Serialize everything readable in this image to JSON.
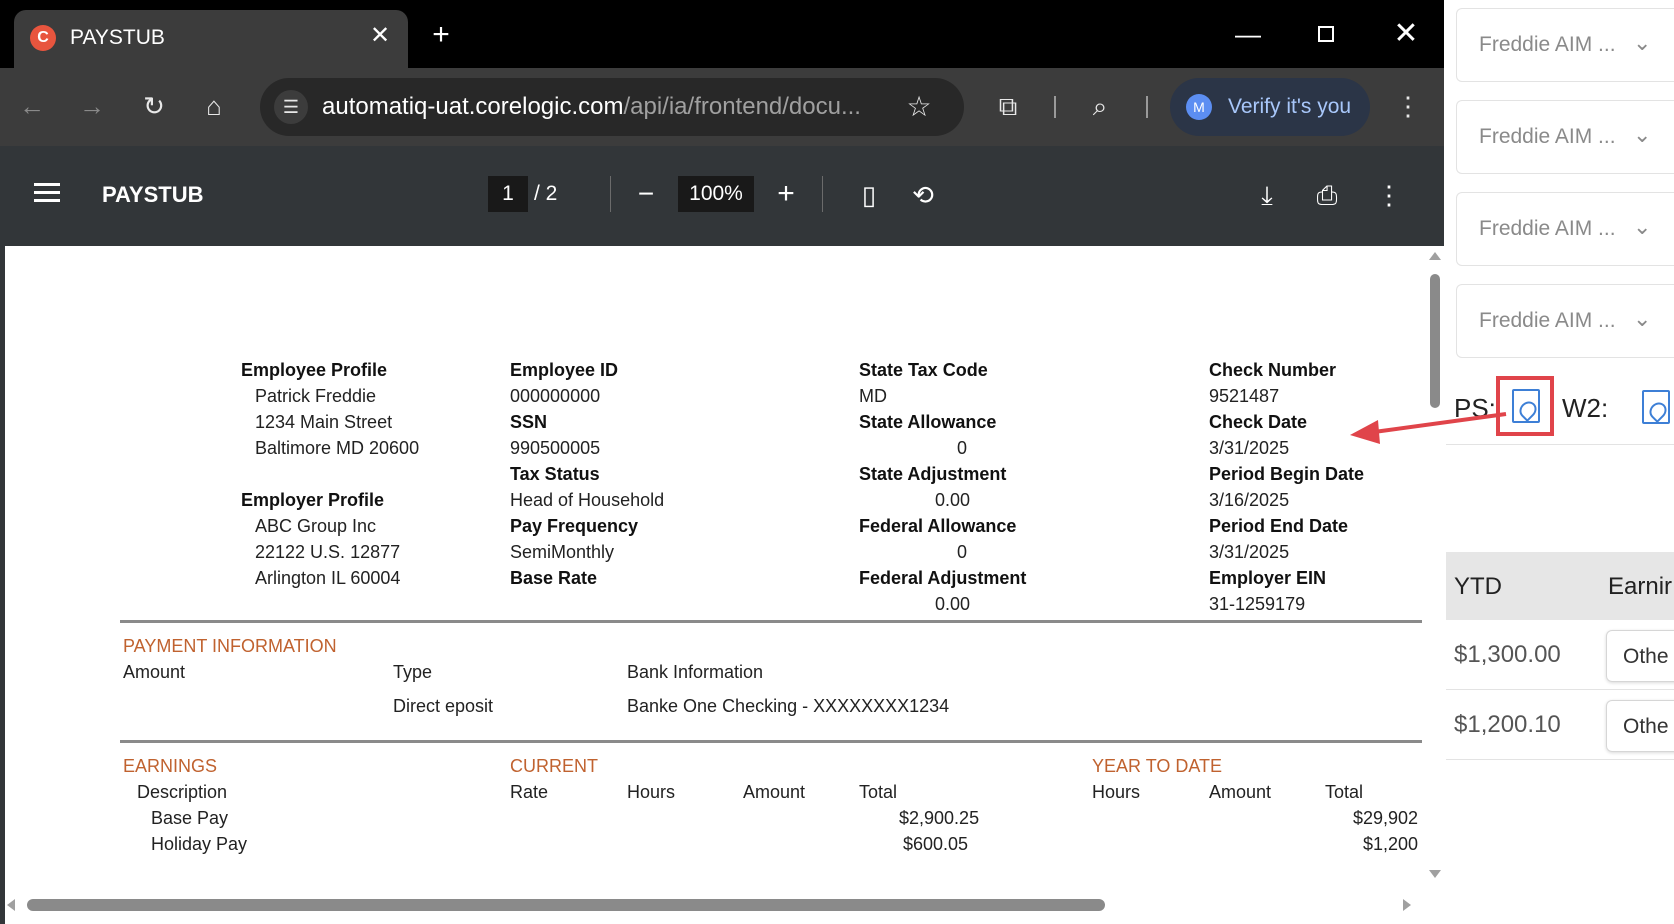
{
  "browser": {
    "tab_title": "PAYSTUB",
    "url_host": "automatiq-uat.corelogic.com",
    "url_path": "/api/ia/frontend/docu...",
    "verify_label": "Verify it's you",
    "avatar_initial": "M"
  },
  "pdf_viewer": {
    "title": "PAYSTUB",
    "current_page": "1",
    "page_total": "/ 2",
    "zoom": "100%"
  },
  "document": {
    "col1": {
      "employee_profile_label": "Employee Profile",
      "employee_name": "Patrick  Freddie",
      "employee_street": "1234 Main Street",
      "employee_city": "Baltimore MD 20600",
      "employer_profile_label": "Employer Profile",
      "employer_name": "ABC Group Inc",
      "employer_street": "22122 U.S. 12877",
      "employer_city": "Arlington IL 60004"
    },
    "col2": {
      "employee_id_label": "Employee ID",
      "employee_id": "000000000",
      "ssn_label": "SSN",
      "ssn": "990500005",
      "tax_status_label": "Tax Status",
      "tax_status": "Head of Household",
      "pay_frequency_label": "Pay Frequency",
      "pay_frequency": "SemiMonthly",
      "base_rate_label": "Base Rate"
    },
    "col3": {
      "state_tax_code_label": "State Tax Code",
      "state_tax_code": "MD",
      "state_allowance_label": "State Allowance",
      "state_allowance": "0",
      "state_adjustment_label": "State Adjustment",
      "state_adjustment": "0.00",
      "federal_allowance_label": "Federal Allowance",
      "federal_allowance": "0",
      "federal_adjustment_label": "Federal Adjustment",
      "federal_adjustment": "0.00"
    },
    "col4": {
      "check_number_label": "Check Number",
      "check_number": "9521487",
      "check_date_label": "Check Date",
      "check_date": "3/31/2025",
      "period_begin_label": "Period Begin Date",
      "period_begin": "3/16/2025",
      "period_end_label": "Period End Date",
      "period_end": "3/31/2025",
      "employer_ein_label": "Employer EIN",
      "employer_ein": "31-1259179"
    },
    "payment": {
      "heading": "PAYMENT INFORMATION",
      "amount_label": "Amount",
      "type_label": "Type",
      "bank_label": "Bank Information",
      "type_value": "Direct eposit",
      "bank_value": "Banke One Checking - XXXXXXXX1234"
    },
    "earnings": {
      "heading": "EARNINGS",
      "current_heading": "CURRENT",
      "ytd_heading": "YEAR TO DATE",
      "columns": {
        "description": "Description",
        "rate": "Rate",
        "hours": "Hours",
        "amount": "Amount",
        "total": "Total",
        "ytd_hours": "Hours",
        "ytd_amount": "Amount",
        "ytd_total": "Total"
      },
      "rows": [
        {
          "description": "Base Pay",
          "current_total": "$2,900.25",
          "ytd_total": "$29,902"
        },
        {
          "description": "Holiday Pay",
          "current_total": "$600.05",
          "ytd_total": "$1,200"
        }
      ]
    }
  },
  "side_panel": {
    "selects": [
      "Freddie AIM ...",
      "Freddie AIM ...",
      "Freddie AIM ...",
      "Freddie AIM ..."
    ],
    "ps_label": "PS:",
    "w2_label": "W2:",
    "table": {
      "ytd_header": "YTD",
      "earnings_header": "Earnir",
      "rows": [
        {
          "ytd": "$1,300.00",
          "earning_type": "Othe"
        },
        {
          "ytd": "$1,200.10",
          "earning_type": "Othe"
        }
      ]
    }
  },
  "icons": {
    "favicon": "corelogic-c-icon",
    "annotation_color": "#e0444a",
    "pdf_icon_color": "#3d7fd6"
  }
}
